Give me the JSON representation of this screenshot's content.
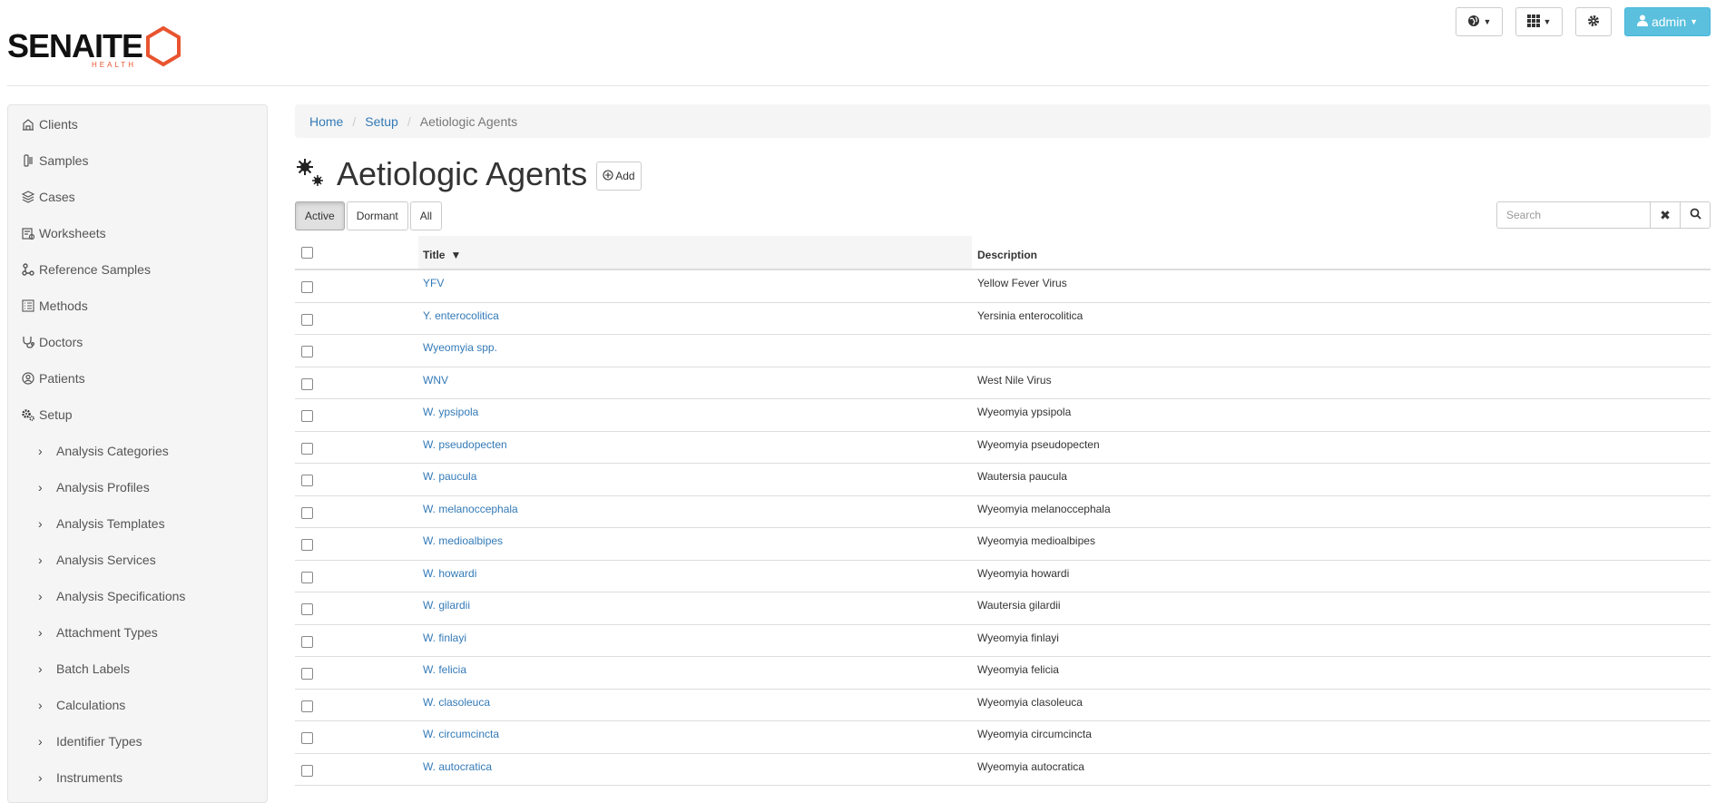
{
  "header": {
    "logo_text": "SENAITE",
    "logo_sub": "HEALTH",
    "language_icon": "globe-icon",
    "apps_icon": "grid-icon",
    "settings_icon": "gear-icon",
    "user_label": "admin"
  },
  "sidebar": {
    "items": [
      {
        "label": "Clients",
        "icon": "building-icon"
      },
      {
        "label": "Samples",
        "icon": "sample-icon"
      },
      {
        "label": "Cases",
        "icon": "layers-icon"
      },
      {
        "label": "Worksheets",
        "icon": "worksheet-icon"
      },
      {
        "label": "Reference Samples",
        "icon": "reference-icon"
      },
      {
        "label": "Methods",
        "icon": "list-icon"
      },
      {
        "label": "Doctors",
        "icon": "stethoscope-icon"
      },
      {
        "label": "Patients",
        "icon": "person-icon"
      },
      {
        "label": "Setup",
        "icon": "gears-icon"
      }
    ],
    "setup_children": [
      "Analysis Categories",
      "Analysis Profiles",
      "Analysis Templates",
      "Analysis Services",
      "Analysis Specifications",
      "Attachment Types",
      "Batch Labels",
      "Calculations",
      "Identifier Types",
      "Instruments"
    ]
  },
  "breadcrumb": {
    "home": "Home",
    "setup": "Setup",
    "current": "Aetiologic Agents"
  },
  "page": {
    "title": "Aetiologic Agents",
    "add_label": "Add"
  },
  "filters": {
    "active": "Active",
    "dormant": "Dormant",
    "all": "All"
  },
  "search": {
    "placeholder": "Search"
  },
  "table": {
    "columns": {
      "title": "Title",
      "sort_indicator": "▼",
      "description": "Description"
    },
    "rows": [
      {
        "title": "YFV",
        "description": "Yellow Fever Virus"
      },
      {
        "title": "Y. enterocolitica",
        "description": "Yersinia enterocolitica"
      },
      {
        "title": "Wyeomyia spp.",
        "description": ""
      },
      {
        "title": "WNV",
        "description": "West Nile Virus"
      },
      {
        "title": "W. ypsipola",
        "description": "Wyeomyia ypsipola"
      },
      {
        "title": "W. pseudopecten",
        "description": "Wyeomyia pseudopecten"
      },
      {
        "title": "W. paucula",
        "description": "Wautersia paucula"
      },
      {
        "title": "W. melanoccephala",
        "description": "Wyeomyia melanoccephala"
      },
      {
        "title": "W. medioalbipes",
        "description": "Wyeomyia medioalbipes"
      },
      {
        "title": "W. howardi",
        "description": "Wyeomyia howardi"
      },
      {
        "title": "W. gilardii",
        "description": "Wautersia gilardii"
      },
      {
        "title": "W. finlayi",
        "description": "Wyeomyia finlayi"
      },
      {
        "title": "W. felicia",
        "description": "Wyeomyia felicia"
      },
      {
        "title": "W. clasoleuca",
        "description": "Wyeomyia clasoleuca"
      },
      {
        "title": "W. circumcincta",
        "description": "Wyeomyia circumcincta"
      },
      {
        "title": "W. autocratica",
        "description": "Wyeomyia autocratica"
      }
    ]
  },
  "colors": {
    "brand_orange": "#e8542f",
    "link": "#337ab7",
    "admin_button": "#5bc0de"
  }
}
